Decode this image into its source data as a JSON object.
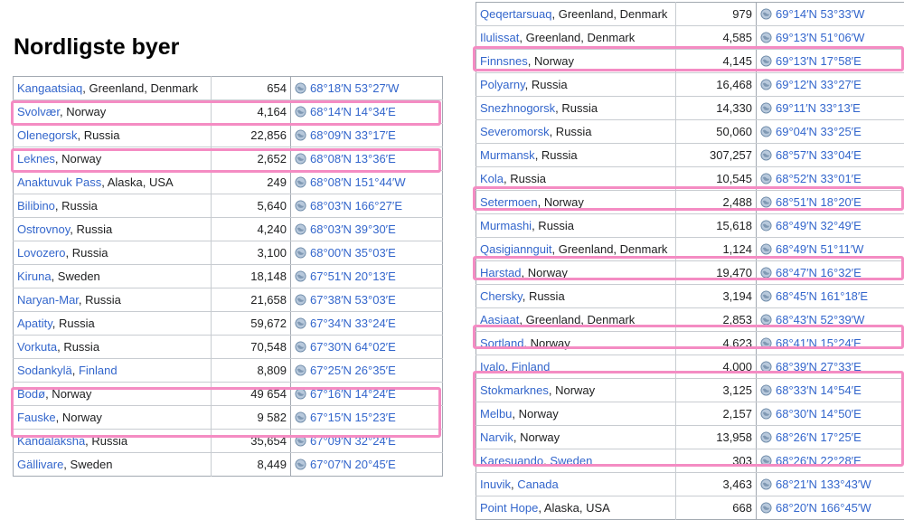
{
  "title": "Nordligste byer",
  "left_rows": [
    {
      "city": "Kangaatsiaq",
      "region": ", Greenland, Denmark",
      "population": "654",
      "coords": "68°18′N 53°27′W"
    },
    {
      "city": "Svolvær",
      "region": ", Norway",
      "population": "4,164",
      "coords": "68°14′N 14°34′E"
    },
    {
      "city": "Olenegorsk",
      "region": ", Russia",
      "population": "22,856",
      "coords": "68°09′N 33°17′E"
    },
    {
      "city": "Leknes",
      "region": ", Norway",
      "population": "2,652",
      "coords": "68°08′N 13°36′E"
    },
    {
      "city": "Anaktuvuk Pass",
      "region": ", Alaska, USA",
      "population": "249",
      "coords": "68°08′N 151°44′W"
    },
    {
      "city": "Bilibino",
      "region": ", Russia",
      "population": "5,640",
      "coords": "68°03′N 166°27′E"
    },
    {
      "city": "Ostrovnoy",
      "region": ", Russia",
      "population": "4,240",
      "coords": "68°03′N 39°30′E"
    },
    {
      "city": "Lovozero",
      "region": ", Russia",
      "population": "3,100",
      "coords": "68°00′N 35°03′E"
    },
    {
      "city": "Kiruna",
      "region": ", Sweden",
      "population": "18,148",
      "coords": "67°51′N 20°13′E"
    },
    {
      "city": "Naryan-Mar",
      "region": ", Russia",
      "population": "21,658",
      "coords": "67°38′N 53°03′E"
    },
    {
      "city": "Apatity",
      "region": ", Russia",
      "population": "59,672",
      "coords": "67°34′N 33°24′E"
    },
    {
      "city": "Vorkuta",
      "region": ", Russia",
      "population": "70,548",
      "coords": "67°30′N 64°02′E"
    },
    {
      "city": "Sodankylä",
      "region": ", ",
      "region_link": "Finland",
      "population": "8,809",
      "coords": "67°25′N 26°35′E"
    },
    {
      "city": "Bodø",
      "region": ", Norway",
      "population": "49 654",
      "coords": "67°16′N 14°24′E"
    },
    {
      "city": "Fauske",
      "region": ", Norway",
      "population": "9 582",
      "coords": "67°15′N 15°23′E"
    },
    {
      "city": "Kandalaksha",
      "region": ", Russia",
      "population": "35,654",
      "coords": "67°09′N 32°24′E"
    },
    {
      "city": "Gällivare",
      "region": ", Sweden",
      "population": "8,449",
      "coords": "67°07′N 20°45′E"
    }
  ],
  "right_rows": [
    {
      "city": "Qeqertarsuaq",
      "region": ", Greenland, Denmark",
      "population": "979",
      "coords": "69°14′N 53°33′W"
    },
    {
      "city": "Ilulissat",
      "region": ", Greenland, Denmark",
      "population": "4,585",
      "coords": "69°13′N 51°06′W"
    },
    {
      "city": "Finnsnes",
      "region": ", Norway",
      "population": "4,145",
      "coords": "69°13′N 17°58′E"
    },
    {
      "city": "Polyarny",
      "region": ", Russia",
      "population": "16,468",
      "coords": "69°12′N 33°27′E"
    },
    {
      "city": "Snezhnogorsk",
      "region": ", Russia",
      "population": "14,330",
      "coords": "69°11′N 33°13′E"
    },
    {
      "city": "Severomorsk",
      "region": ", Russia",
      "population": "50,060",
      "coords": "69°04′N 33°25′E"
    },
    {
      "city": "Murmansk",
      "region": ", Russia",
      "population": "307,257",
      "coords": "68°57′N 33°04′E"
    },
    {
      "city": "Kola",
      "region": ", Russia",
      "population": "10,545",
      "coords": "68°52′N 33°01′E"
    },
    {
      "city": "Setermoen",
      "region": ", Norway",
      "population": "2,488",
      "coords": "68°51′N 18°20′E"
    },
    {
      "city": "Murmashi",
      "region": ", Russia",
      "population": "15,618",
      "coords": "68°49′N 32°49′E"
    },
    {
      "city": "Qasigiannguit",
      "region": ", Greenland, Denmark",
      "population": "1,124",
      "coords": "68°49′N 51°11′W"
    },
    {
      "city": "Harstad",
      "region": ", Norway",
      "population": "19,470",
      "coords": "68°47′N 16°32′E"
    },
    {
      "city": "Chersky",
      "region": ", Russia",
      "population": "3,194",
      "coords": "68°45′N 161°18′E"
    },
    {
      "city": "Aasiaat",
      "region": ", Greenland, Denmark",
      "population": "2,853",
      "coords": "68°43′N 52°39′W"
    },
    {
      "city": "Sortland",
      "region": ", Norway",
      "population": "4,623",
      "coords": "68°41′N 15°24′E"
    },
    {
      "city": "Ivalo",
      "region": ", ",
      "region_link": "Finland",
      "population": "4,000",
      "coords": "68°39′N 27°33′E"
    },
    {
      "city": "Stokmarknes",
      "region": ", Norway",
      "population": "3,125",
      "coords": "68°33′N 14°54′E"
    },
    {
      "city": "Melbu",
      "region": ", Norway",
      "population": "2,157",
      "coords": "68°30′N 14°50′E"
    },
    {
      "city": "Narvik",
      "region": ", Norway",
      "population": "13,958",
      "coords": "68°26′N 17°25′E"
    },
    {
      "city": "Karesuando",
      "region": ", ",
      "region_link": "Sweden",
      "population": "303",
      "coords": "68°26′N 22°28′E"
    },
    {
      "city": "Inuvik",
      "region": ", ",
      "region_link": "Canada",
      "population": "3,463",
      "coords": "68°21′N 133°43′W"
    },
    {
      "city": "Point Hope",
      "region": ", Alaska, USA",
      "population": "668",
      "coords": "68°20′N 166°45′W"
    }
  ],
  "colors": {
    "link": "#3366cc",
    "highlight": "#f48cc3",
    "border": "#a2a9b1"
  },
  "icons": {
    "coordinate": "globe-icon"
  }
}
